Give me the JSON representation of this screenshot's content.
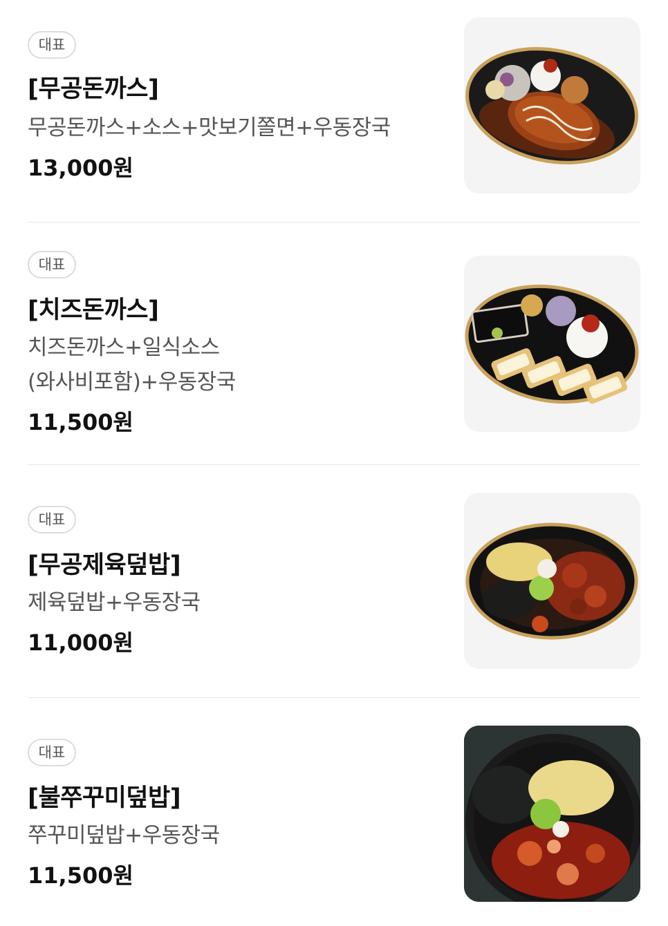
{
  "menu": {
    "items": [
      {
        "badge": "대표",
        "name": "[무공돈까스]",
        "description": "무공돈까스+소스+맛보기쫄면+우동장국",
        "price": "13,000원",
        "image": "pork-cutlet-with-sauce-photo"
      },
      {
        "badge": "대표",
        "name": "[치즈돈까스]",
        "description": "치즈돈까스+일식소스(와사비포함)+우동장국",
        "price": "11,500원",
        "image": "cheese-cutlet-photo"
      },
      {
        "badge": "대표",
        "name": "[무공제육덮밥]",
        "description": "제육덮밥+우동장국",
        "price": "11,000원",
        "image": "spicy-pork-rice-bowl-photo"
      },
      {
        "badge": "대표",
        "name": "[불쭈꾸미덮밥]",
        "description": "쭈꾸미덮밥+우동장국",
        "price": "11,500원",
        "image": "spicy-webfoot-octopus-rice-bowl-photo"
      }
    ]
  }
}
